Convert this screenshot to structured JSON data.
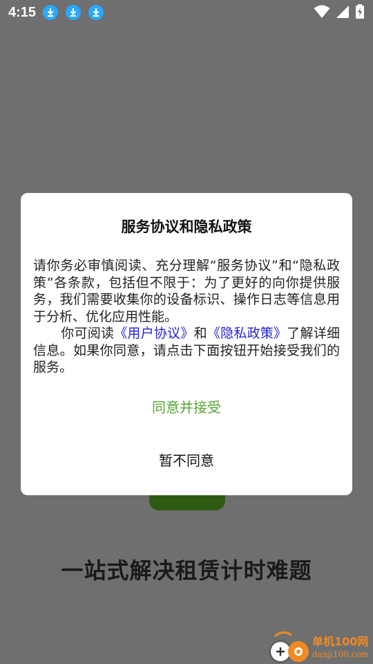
{
  "status_bar": {
    "time": "4:15",
    "notification_icons": [
      "download-icon",
      "download-icon",
      "download-icon"
    ],
    "right_icons": [
      "wifi-icon",
      "signal-icon",
      "battery-charging-icon"
    ]
  },
  "background": {
    "slogan": "一站式解决租赁计时难题",
    "button_color": "#2f5a14"
  },
  "dialog": {
    "title": "服务协议和隐私政策",
    "paragraph1": "请你务必审慎阅读、充分理解“服务协议”和“隐私政策”各条款，包括但不限于：为了更好的向你提供服务，我们需要收集你的设备标识、操作日志等信息用于分析、优化应用性能。",
    "paragraph2_prefix": "你可阅读",
    "user_agreement_link": "《用户协议》",
    "and_text": "和",
    "privacy_policy_link": "《隐私政策》",
    "paragraph2_suffix": "了解详细信息。如果你同意，请点击下面按钮开始接受我们的服务。",
    "agree_label": "同意并接受",
    "disagree_label": "暂不同意",
    "link_color": "#2323d4",
    "agree_color": "#57a534"
  },
  "watermark": {
    "cn": "单机100网",
    "en": "danji100.com"
  }
}
